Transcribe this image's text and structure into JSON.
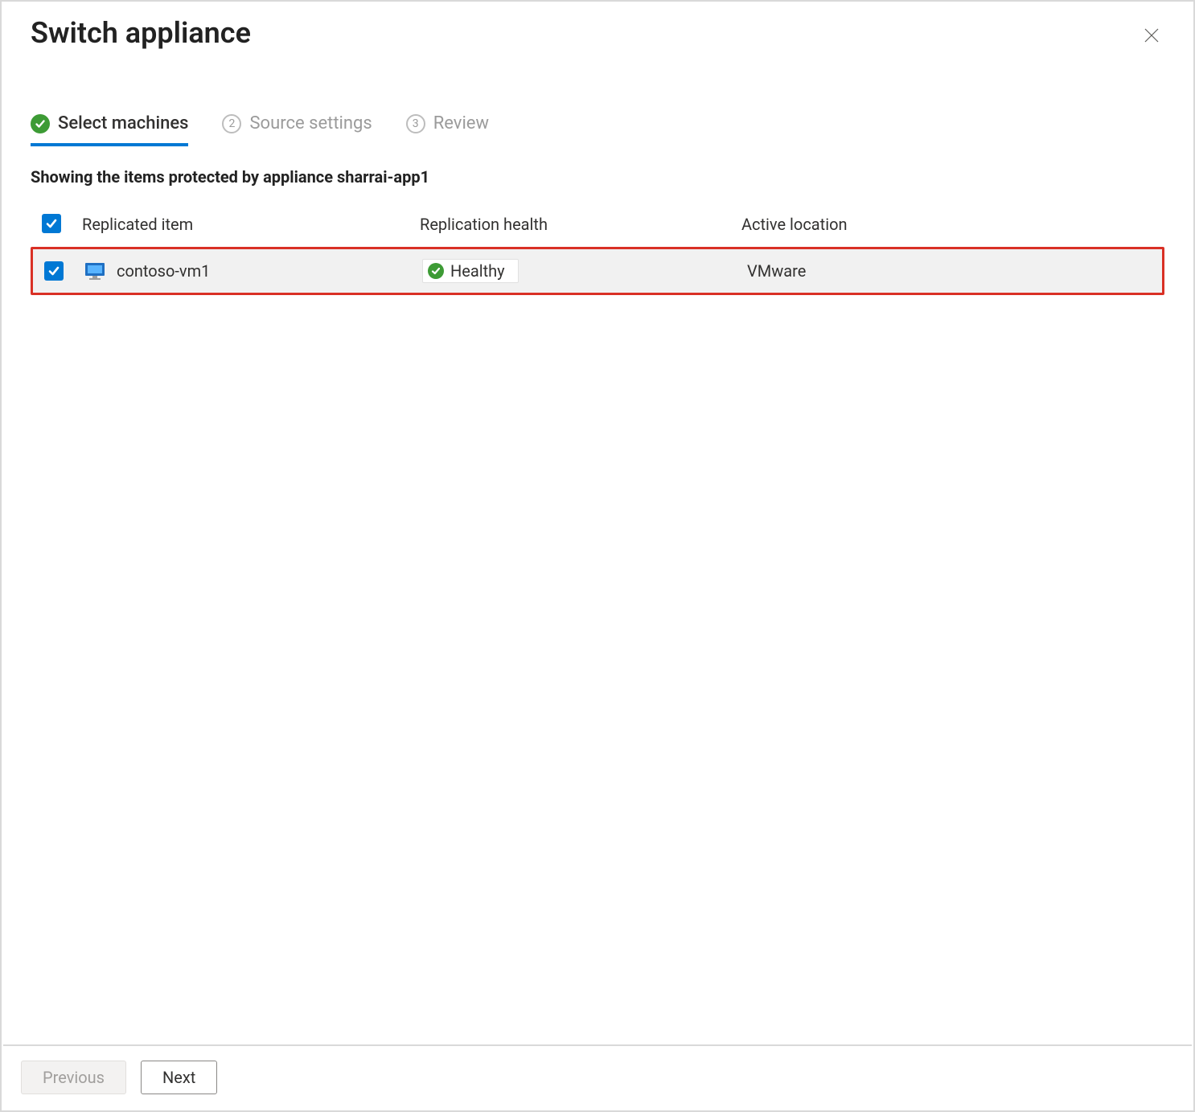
{
  "title": "Switch appliance",
  "steps": [
    {
      "label": "Select machines",
      "state": "active-complete"
    },
    {
      "num": "2",
      "label": "Source settings",
      "state": "inactive"
    },
    {
      "num": "3",
      "label": "Review",
      "state": "inactive"
    }
  ],
  "subtitle": "Showing the items protected by appliance sharrai-app1",
  "columns": {
    "replicated_item": "Replicated item",
    "replication_health": "Replication health",
    "active_location": "Active location"
  },
  "rows": [
    {
      "checked": true,
      "name": "contoso-vm1",
      "health": "Healthy",
      "health_state": "healthy",
      "location": "VMware"
    }
  ],
  "footer": {
    "previous": "Previous",
    "next": "Next"
  }
}
